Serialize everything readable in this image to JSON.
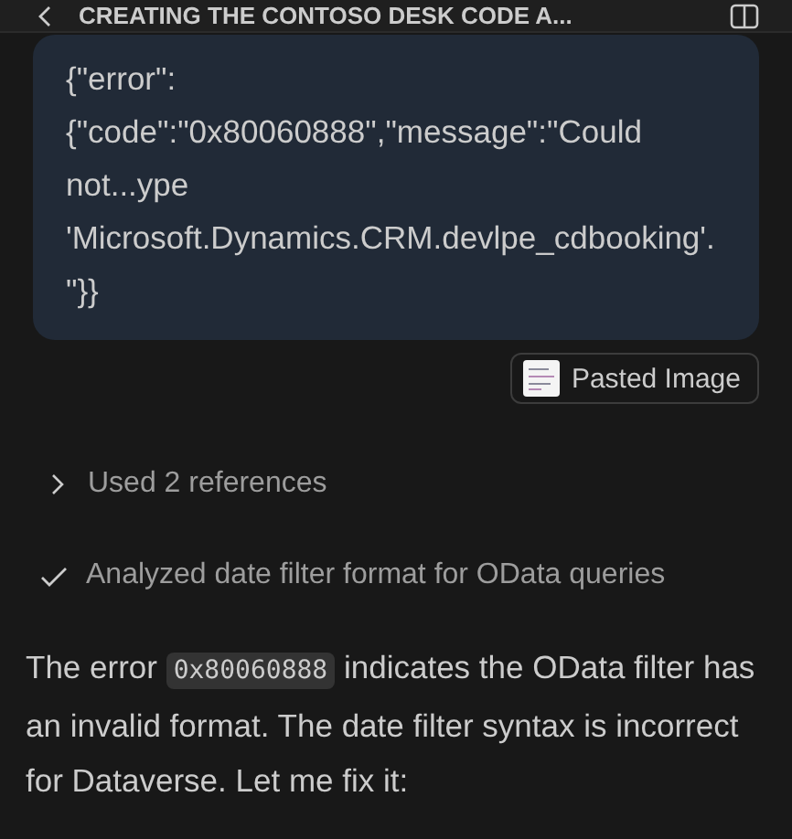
{
  "header": {
    "title": "CREATING THE CONTOSO DESK CODE A..."
  },
  "user_message": {
    "text": "{\"error\":{\"code\":\"0x80060888\",\"message\":\"Could not...ype 'Microsoft.Dynamics.CRM.devlpe_cdbooking'.\"}}",
    "attachments": [
      {
        "label": "Pasted Image"
      }
    ]
  },
  "steps": [
    {
      "kind": "collapsible",
      "label": "Used 2 references",
      "expanded": false
    },
    {
      "kind": "done",
      "label": "Analyzed date filter format for OData queries"
    }
  ],
  "reply": {
    "parts": [
      {
        "kind": "text",
        "text": "The error "
      },
      {
        "kind": "code",
        "text": "0x80060888"
      },
      {
        "kind": "text",
        "text": " indicates the OData filter has an invalid format. The date filter syntax is incorrect for Dataverse. Let me fix it:"
      }
    ]
  }
}
